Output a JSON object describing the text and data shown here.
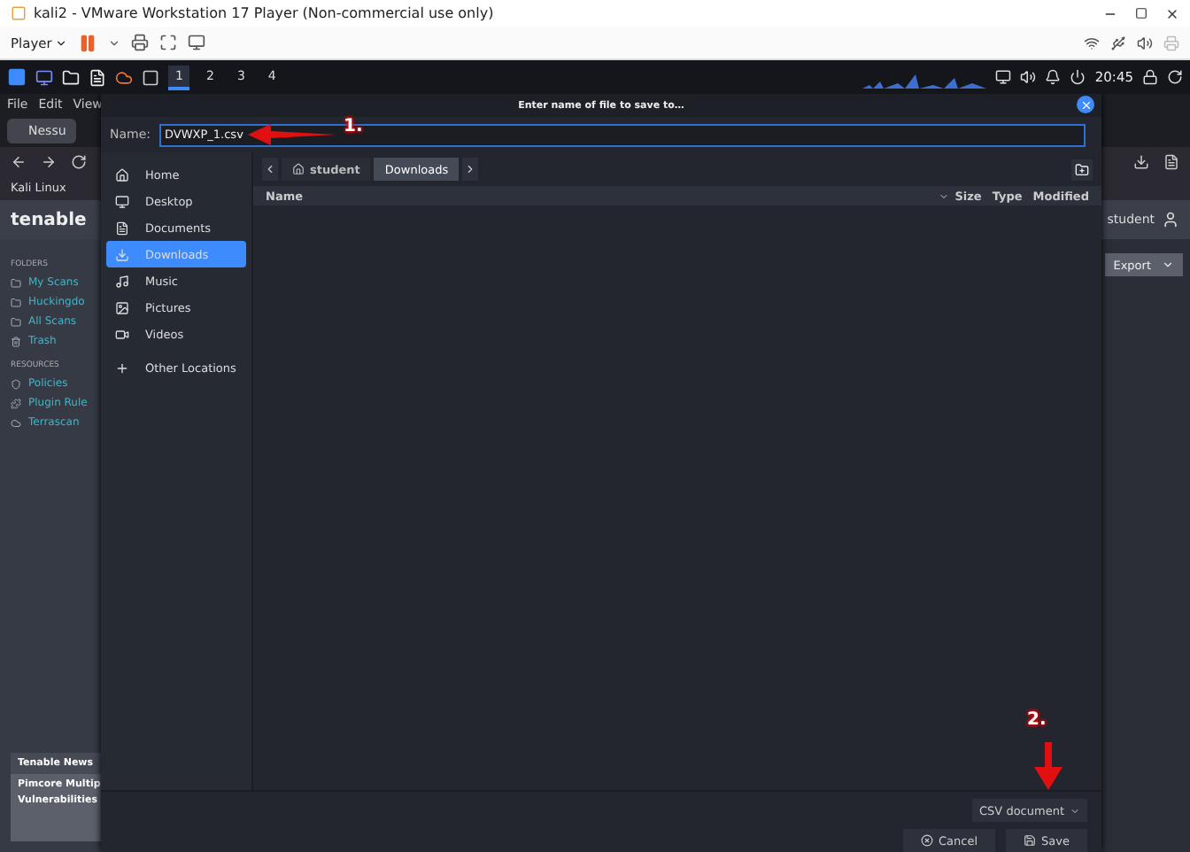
{
  "window": {
    "title": "kali2 - VMware Workstation 17 Player (Non-commercial use only)"
  },
  "player_menu": {
    "label": "Player"
  },
  "taskbar": {
    "workspaces": [
      {
        "label": "1",
        "selected": true
      },
      {
        "label": "2",
        "selected": false
      },
      {
        "label": "3",
        "selected": false
      },
      {
        "label": "4",
        "selected": false
      }
    ],
    "clock": "20:45"
  },
  "browser": {
    "menu": [
      "File",
      "Edit",
      "View"
    ],
    "tab": "Nessu",
    "bookmark": "Kali Linux",
    "logo": "tenable",
    "folders_heading": "FOLDERS",
    "folders": [
      "My Scans",
      "Huckingdo",
      "All Scans",
      "Trash"
    ],
    "resources_heading": "RESOURCES",
    "resources": [
      "Policies",
      "Plugin Rule",
      "Terrascan"
    ],
    "news": {
      "title": "Tenable News",
      "lines": [
        "Pimcore Multip",
        "Vulnerabilities"
      ]
    },
    "user": "student",
    "export": "Export"
  },
  "dialog": {
    "title": "Enter name of file to save to…",
    "name_label": "Name:",
    "file_name": "DVWXP_1.csv",
    "places": [
      {
        "label": "Home",
        "kind": "home",
        "selected": false
      },
      {
        "label": "Desktop",
        "kind": "desktop",
        "selected": false
      },
      {
        "label": "Documents",
        "kind": "documents",
        "selected": false
      },
      {
        "label": "Downloads",
        "kind": "downloads",
        "selected": true
      },
      {
        "label": "Music",
        "kind": "music",
        "selected": false
      },
      {
        "label": "Pictures",
        "kind": "pictures",
        "selected": false
      },
      {
        "label": "Videos",
        "kind": "videos",
        "selected": false
      },
      {
        "label": "Other Locations",
        "kind": "other",
        "selected": false
      }
    ],
    "path": [
      {
        "label": "student",
        "selected": false
      },
      {
        "label": "Downloads",
        "selected": true
      }
    ],
    "columns": [
      "Name",
      "Size",
      "Type",
      "Modified"
    ],
    "file_type": "CSV document",
    "buttons": [
      {
        "label": "Cancel",
        "kind": "cancel"
      },
      {
        "label": "Save",
        "kind": "save"
      }
    ]
  },
  "annotations": [
    {
      "label": "1."
    },
    {
      "label": "2."
    }
  ]
}
